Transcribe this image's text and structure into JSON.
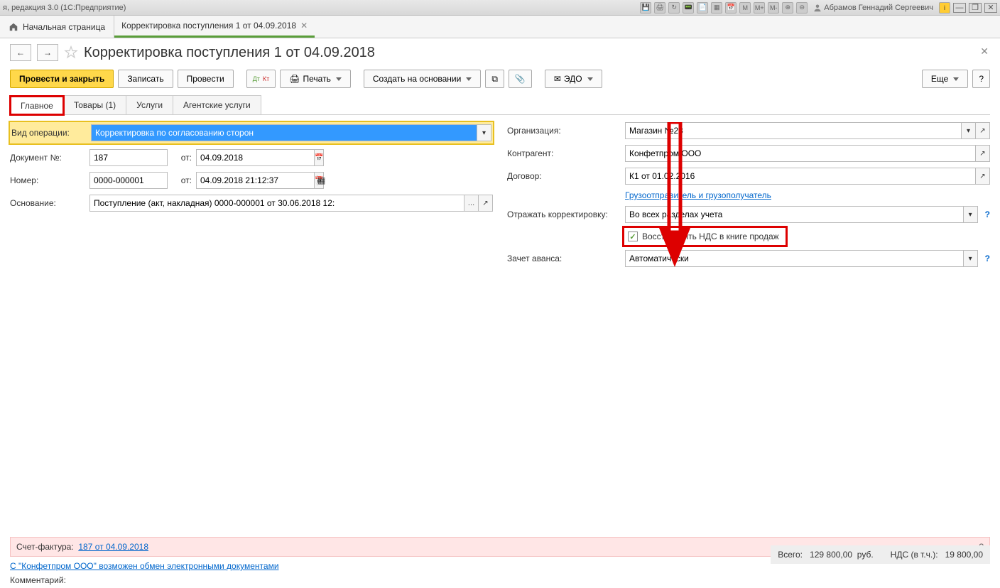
{
  "sysbar": {
    "title": "я, редакция 3.0  (1С:Предприятие)",
    "user": "Абрамов Геннадий Сергеевич",
    "icons": [
      "M",
      "M+",
      "M-"
    ]
  },
  "tabrow": {
    "home": "Начальная страница",
    "doc": "Корректировка поступления 1 от 04.09.2018"
  },
  "header": {
    "title": "Корректировка поступления 1 от 04.09.2018"
  },
  "toolbar": {
    "post_close": "Провести и закрыть",
    "write": "Записать",
    "post": "Провести",
    "print": "Печать",
    "create_based": "Создать на основании",
    "edo": "ЭДО",
    "more": "Еще",
    "help": "?"
  },
  "subtabs": {
    "main": "Главное",
    "goods": "Товары (1)",
    "services": "Услуги",
    "agent": "Агентские услуги"
  },
  "form": {
    "op_type_label": "Вид операции:",
    "op_type_value": "Корректировка по согласованию сторон",
    "doc_no_label": "Документ №:",
    "doc_no_value": "187",
    "from_label": "от:",
    "doc_date_value": "04.09.2018",
    "number_label": "Номер:",
    "number_value": "0000-000001",
    "number_date_value": "04.09.2018 21:12:37",
    "basis_label": "Основание:",
    "basis_value": "Поступление (акт, накладная) 0000-000001 от 30.06.2018 12:",
    "org_label": "Организация:",
    "org_value": "Магазин №23",
    "counter_label": "Контрагент:",
    "counter_value": "Конфетпром ООО",
    "contract_label": "Договор:",
    "contract_value": "К1 от 01.02.2016",
    "ship_link": "Грузоотправитель и грузополучатель",
    "reflect_label": "Отражать корректировку:",
    "reflect_value": "Во всех разделах учета",
    "restore_vat": "Восстановить НДС в книге продаж",
    "advance_label": "Зачет аванса:",
    "advance_value": "Автоматически"
  },
  "footer": {
    "sf_label": "Счет-фактура:",
    "sf_link": "187 от 04.09.2018",
    "edo_link": "С \"Конфетпром ООО\" возможен обмен электронными документами",
    "comment_label": "Комментарий:",
    "total_label": "Всего:",
    "total_value": "129 800,00",
    "currency": "руб.",
    "vat_label": "НДС (в т.ч.):",
    "vat_value": "19 800,00"
  }
}
